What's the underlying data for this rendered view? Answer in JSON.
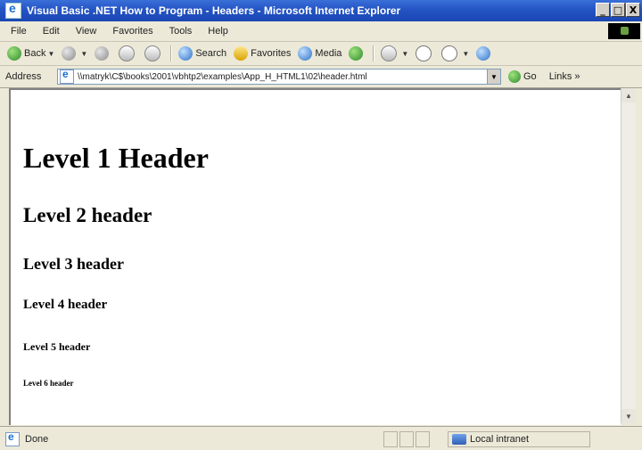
{
  "window": {
    "title": "Visual Basic .NET How to Program - Headers - Microsoft Internet Explorer",
    "controls": {
      "minimize": "_",
      "maximize": "□",
      "close": "X"
    }
  },
  "menu": [
    "File",
    "Edit",
    "View",
    "Favorites",
    "Tools",
    "Help"
  ],
  "toolbar": {
    "back": "Back",
    "search": "Search",
    "favorites": "Favorites",
    "media": "Media"
  },
  "address": {
    "label": "Address",
    "url": "\\\\matryk\\C$\\books\\2001\\vbhtp2\\examples\\App_H_HTML1\\02\\header.html",
    "go": "Go",
    "links": "Links »"
  },
  "page": {
    "h1": "Level 1 Header",
    "h2": "Level 2 header",
    "h3": "Level 3 header",
    "h4": "Level 4 header",
    "h5": "Level 5 header",
    "h6": "Level 6 header"
  },
  "status": {
    "text": "Done",
    "zone": "Local intranet"
  },
  "icons": {
    "title": "ie-icon",
    "back": "back-arrow-icon",
    "forward": "forward-arrow-icon",
    "stop": "stop-icon",
    "refresh": "refresh-icon",
    "home": "home-icon",
    "search": "search-icon",
    "favorites": "favorites-star-icon",
    "media": "media-icon",
    "history": "history-icon",
    "mail": "mail-icon",
    "print": "print-icon",
    "edit": "edit-icon",
    "messenger": "messenger-icon"
  }
}
